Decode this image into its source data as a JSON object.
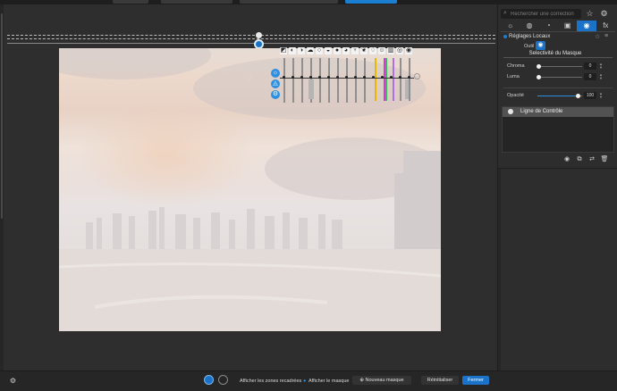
{
  "search": {
    "placeholder": "Rechercher une correction"
  },
  "right_panel": {
    "tool_tabs": [
      {
        "icon": "sun-icon",
        "glyph": "☼"
      },
      {
        "icon": "color-wheel-icon",
        "glyph": "◍"
      },
      {
        "icon": "lens-icon",
        "glyph": "◔"
      },
      {
        "icon": "crop-frame-icon",
        "glyph": "▣"
      },
      {
        "icon": "local-adjust-icon",
        "glyph": "◉",
        "active": true
      },
      {
        "icon": "fx-icon",
        "glyph": "fx"
      }
    ],
    "section_title": "Réglages Locaux",
    "outil_label": "Outil",
    "mask_selectivity_title": "Selectivité du Masque",
    "sliders": [
      {
        "label": "Chroma",
        "value": "0",
        "level": 0.0
      },
      {
        "label": "Luma",
        "value": "0",
        "level": 0.0
      },
      {
        "label": "Opacité",
        "value": "100",
        "level": 1.0
      }
    ],
    "layers": [
      {
        "name": "Ligne de Contrôle"
      }
    ]
  },
  "bottom_bar": {
    "show_cropped_label": "Afficher les zones recadrées",
    "show_mask_label": "Afficher le masque",
    "new_mask_label": "Nouveau masque",
    "reset_label": "Réinitialiser",
    "close_label": "Fermer"
  },
  "colors": {
    "accent": "#1a73c8",
    "panel": "#2d2d2d",
    "canvas": "#2e2e2e"
  }
}
